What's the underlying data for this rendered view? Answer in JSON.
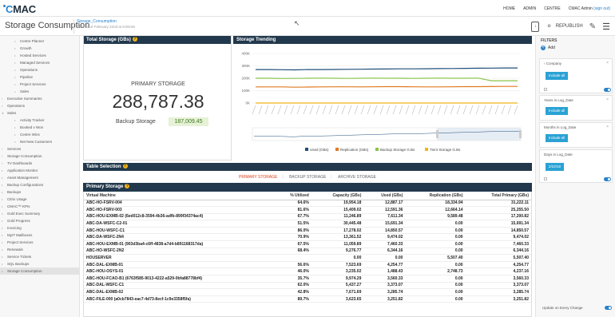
{
  "topbar": {
    "logo_prefix": "C",
    "logo_rest": "MAC",
    "nav": {
      "home": "HOME",
      "admin": "ADMIN",
      "centre": "CENTRE",
      "user": "CMAC Admin",
      "signout": "(sign out)"
    }
  },
  "header": {
    "page_title": "Storage Consumption",
    "subtitle": "Storage_Consumption",
    "date_line": "Data as of February 22nd at 9:00AM",
    "republish": "REPUBLISH"
  },
  "sidebar": {
    "items": [
      {
        "label": "Centre Planner",
        "level": 2,
        "marker": "•"
      },
      {
        "label": "Growth",
        "level": 2,
        "marker": "•"
      },
      {
        "label": "Hosted Services",
        "level": 2,
        "marker": "•"
      },
      {
        "label": "Managed Services",
        "level": 2,
        "marker": "•"
      },
      {
        "label": "Operations",
        "level": 2,
        "marker": "•"
      },
      {
        "label": "Pipeline",
        "level": 2,
        "marker": "•"
      },
      {
        "label": "Project Services",
        "level": 2,
        "marker": "•"
      },
      {
        "label": "Sales",
        "level": 2,
        "marker": "•"
      },
      {
        "label": "Executive Summaries",
        "level": 0,
        "marker": ">"
      },
      {
        "label": "Operations",
        "level": 0,
        "marker": ">"
      },
      {
        "label": "Sales",
        "level": 0,
        "marker": "v"
      },
      {
        "label": "Activity Tracker",
        "level": 2,
        "marker": "•"
      },
      {
        "label": "Booked v Won",
        "level": 2,
        "marker": "•"
      },
      {
        "label": "Centre Wins",
        "level": 2,
        "marker": "•"
      },
      {
        "label": "Net New Customers",
        "level": 2,
        "marker": "•"
      },
      {
        "label": "Services",
        "level": 0,
        "marker": ">"
      },
      {
        "label": "Storage Consumption",
        "level": 0,
        "marker": ">"
      },
      {
        "label": "TV Dashboards",
        "level": 0,
        "marker": ">"
      },
      {
        "label": "Application Monitor",
        "level": 0,
        "marker": "•"
      },
      {
        "label": "Asset Management",
        "level": 0,
        "marker": "•"
      },
      {
        "label": "Backup Configurations",
        "level": 0,
        "marker": "•"
      },
      {
        "label": "Backups",
        "level": 0,
        "marker": "•"
      },
      {
        "label": "Citrix Usage",
        "level": 0,
        "marker": "•"
      },
      {
        "label": "CMAC™ KPIs",
        "level": 0,
        "marker": "•"
      },
      {
        "label": "Gold Exec Summary",
        "level": 0,
        "marker": "•"
      },
      {
        "label": "Gold Progress",
        "level": 0,
        "marker": "•"
      },
      {
        "label": "Invoicing",
        "level": 0,
        "marker": "•"
      },
      {
        "label": "MyIT Mailboxes",
        "level": 0,
        "marker": "•"
      },
      {
        "label": "Project Services",
        "level": 0,
        "marker": "•"
      },
      {
        "label": "Renewals",
        "level": 0,
        "marker": "•"
      },
      {
        "label": "Service Tickets",
        "level": 0,
        "marker": "•"
      },
      {
        "label": "SQL Backups",
        "level": 0,
        "marker": "•"
      },
      {
        "label": "Storage Consumption",
        "level": 0,
        "marker": "•",
        "active": true
      }
    ]
  },
  "total_storage": {
    "heading": "Total Storage (GBs)",
    "primary_label": "PRIMARY STORAGE",
    "primary_value": "288,787.38",
    "backup_label": "Backup Storage",
    "backup_value": "187,009.45"
  },
  "trending": {
    "heading": "Storage Trending"
  },
  "chart_data": {
    "type": "line",
    "title": "Storage Trending",
    "y_ticks": [
      "400K",
      "300K",
      "200K",
      "100K",
      "0K"
    ],
    "ylim": [
      0,
      400000
    ],
    "series": [
      {
        "name": "Used (GBs)",
        "color": "#1f4e79",
        "values": [
          270000,
          270000,
          269000,
          268000,
          270000,
          270000,
          271000,
          272000,
          273000,
          274000,
          275000,
          276000,
          276000,
          277000,
          278000,
          279000,
          280000,
          281000,
          282000,
          283000,
          283000
        ]
      },
      {
        "name": "Replication (GBs)",
        "color": "#e07a22",
        "values": [
          130000,
          130000,
          130000,
          128000,
          129000,
          130000,
          131000,
          131000,
          130000,
          131000,
          132000,
          132000,
          131000,
          130000,
          130000,
          131000,
          132000,
          132000,
          133000,
          134000,
          134000
        ]
      },
      {
        "name": "Backup Storage G.Bs",
        "color": "#8bc34a",
        "values": [
          200000,
          200000,
          198000,
          199000,
          200000,
          201000,
          200000,
          199000,
          200000,
          201000,
          200000,
          200000,
          199000,
          200000,
          201000,
          200000,
          200000,
          201000,
          180000,
          180000,
          180000
        ]
      },
      {
        "name": "Tier3 Storage G.Bs",
        "color": "#f2b417",
        "values": [
          0,
          0,
          0,
          0,
          0,
          0,
          0,
          0,
          0,
          0,
          0,
          0,
          0,
          0,
          0,
          0,
          0,
          0,
          0,
          0,
          0
        ]
      }
    ]
  },
  "table_selection": {
    "heading": "Table Selection",
    "tabs": [
      "PRIMARY STORAGE",
      "BACKUP STORAGE",
      "ARCHIVE STORAGE"
    ]
  },
  "primary_table": {
    "heading": "Primary Storage",
    "columns": [
      "Virtual Machine",
      "% Utilized",
      "Capacity (GBs)",
      "Used (GBs)",
      "Replication (GBs)",
      "Total Primary (GBs)"
    ],
    "rows": [
      [
        "ABC-HO-FSRV-004",
        "64.6%",
        "19,954.18",
        "12,887.17",
        "18,334.94",
        "31,222.11"
      ],
      [
        "ABC-HO-FSRV-003",
        "81.6%",
        "15,409.02",
        "12,591.36",
        "12,664.14",
        "25,255.50"
      ],
      [
        "ABC-HOU-EXMB-02 (6ed012c8-3594-4b36-adfb-899f34374ac4)",
        "67.7%",
        "11,246.89",
        "7,611.34",
        "9,589.48",
        "17,200.82"
      ],
      [
        "ABC-DA-WSFC-C2-01",
        "51.5%",
        "30,445.48",
        "15,691.34",
        "0.00",
        "15,691.34"
      ],
      [
        "ABC-HOU-WSFC-C1",
        "86.0%",
        "17,278.02",
        "14,850.57",
        "0.00",
        "14,850.57"
      ],
      [
        "ABC-DA-WSFC-2N4",
        "70.9%",
        "13,361.52",
        "9,474.02",
        "0.00",
        "9,474.02"
      ],
      [
        "ABC-HOU-EXMB-01 (903d3ba4-c6ff-4838-a7d4-b891168317da)",
        "67.5%",
        "11,059.89",
        "7,460.33",
        "0.00",
        "7,460.33"
      ],
      [
        "ABC-HO-WSFC-2N2",
        "68.4%",
        "9,276.77",
        "6,344.16",
        "0.00",
        "6,344.16"
      ],
      [
        "HOUSERVER",
        "",
        "0.00",
        "0.00",
        "5,507.40",
        "5,507.40"
      ],
      [
        "ABC-DAL-EXMB-01",
        "56.6%",
        "7,523.69",
        "4,254.77",
        "0.00",
        "4,254.77"
      ],
      [
        "ABC-HOU-OSYS-01",
        "46.0%",
        "3,235.02",
        "1,488.43",
        "2,748.73",
        "4,237.16"
      ],
      [
        "ABC-HOU-FCAO-B1 (6763f585-9013-4222-a529-0bfa88778bf4)",
        "35.7%",
        "9,974.29",
        "3,560.33",
        "0.00",
        "3,560.33"
      ],
      [
        "ABC-DAL-WSFC-C1",
        "62.0%",
        "5,437.27",
        "3,373.07",
        "0.00",
        "3,373.07"
      ],
      [
        "ABC-DAL-EXMB-02",
        "42.8%",
        "7,671.69",
        "3,285.74",
        "0.00",
        "3,285.74"
      ],
      [
        "ABC-FILE-000 (a0cb7843-eac7-4d73-8ecf-1c9e3358f5fa)",
        "89.7%",
        "3,623.65",
        "3,251.82",
        "0.00",
        "3,251.82"
      ]
    ]
  },
  "filters": {
    "title": "FILTERS",
    "add": "Add",
    "company": "Company",
    "include_all": "Include all",
    "years": "Years in Log_Date",
    "months": "Months in Log_Date",
    "days": "Days in Log_Date",
    "date_value": "2/22/18",
    "update": "Update on Every Change"
  }
}
